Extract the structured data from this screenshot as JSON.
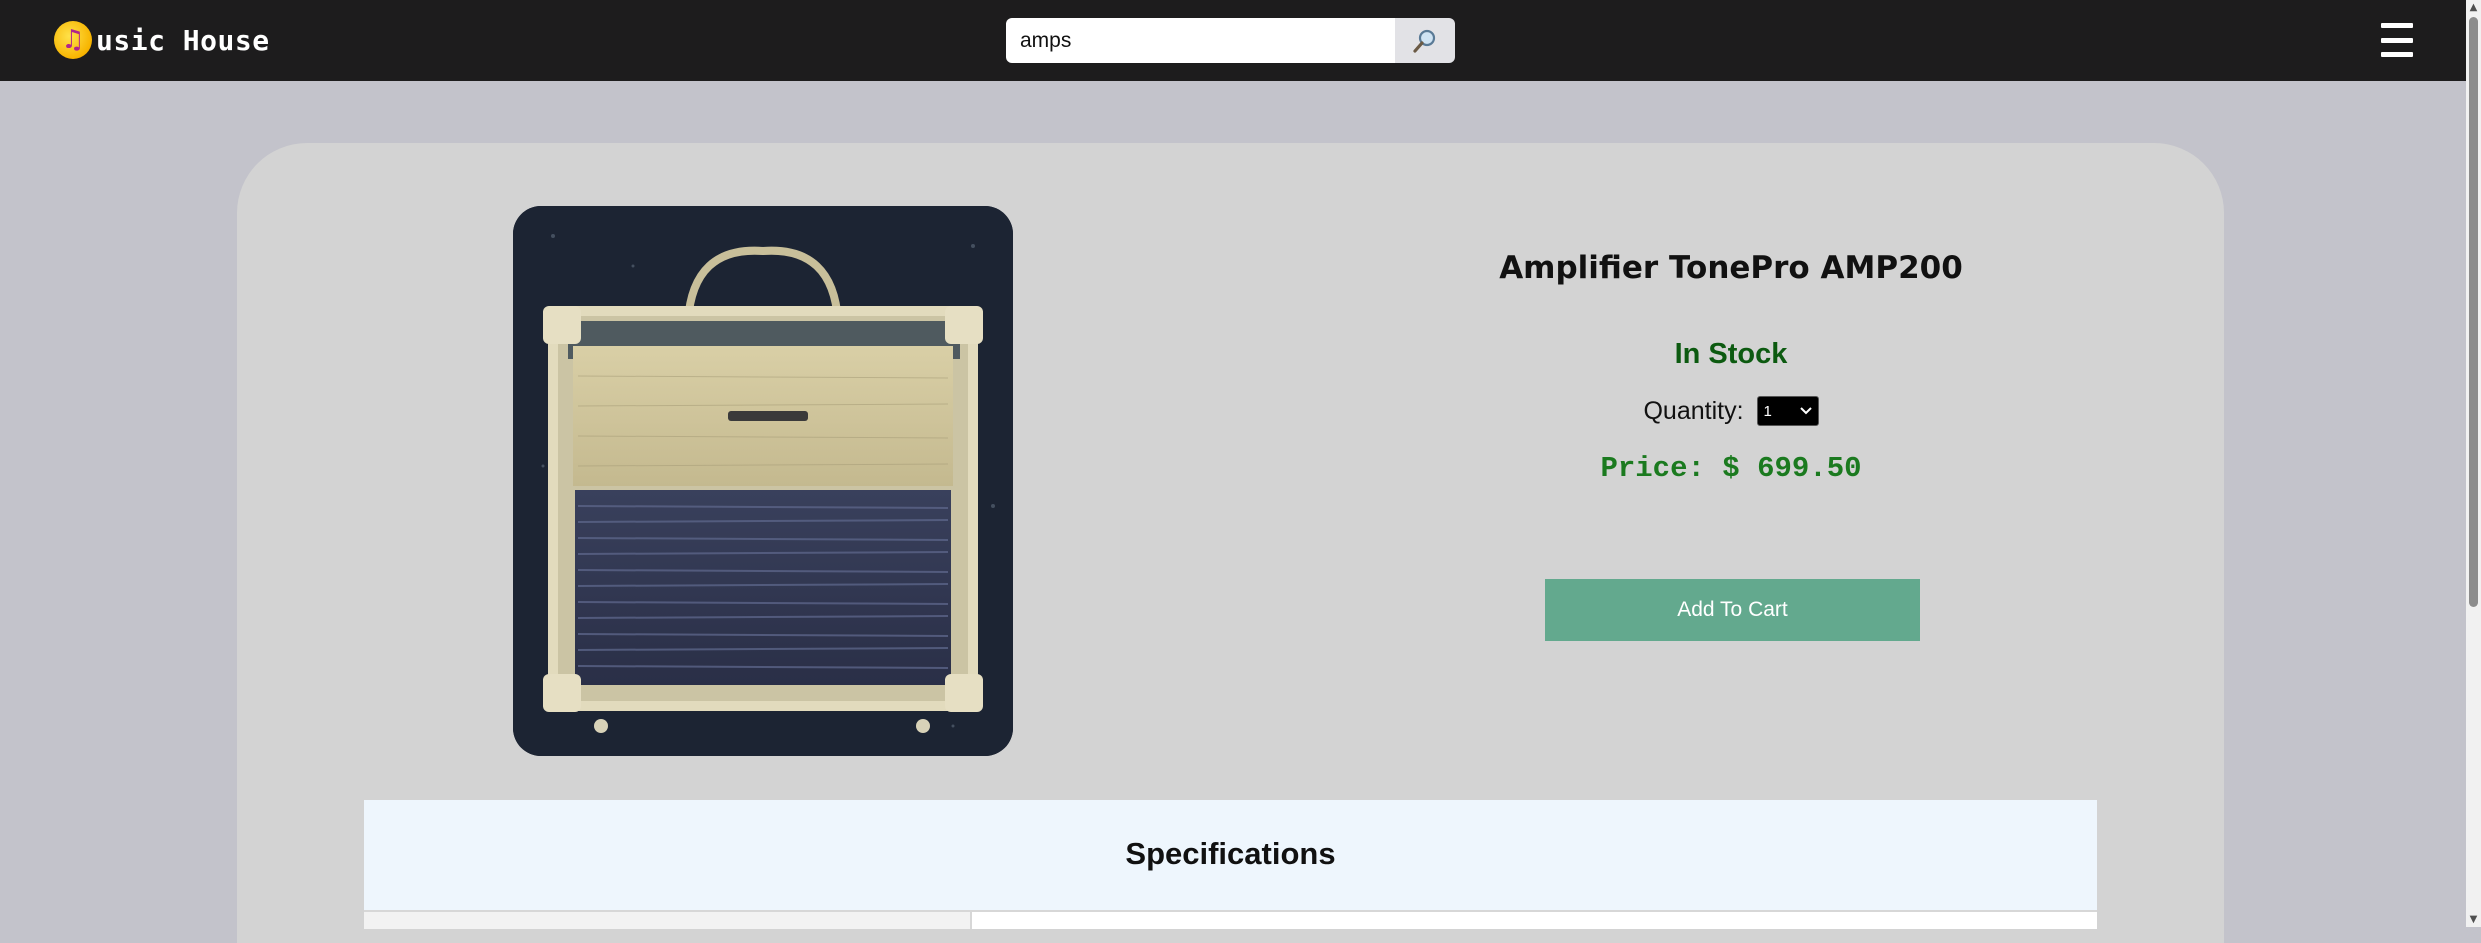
{
  "header": {
    "logo_mark": "♫",
    "logo_text": "usic House",
    "search": {
      "value": "amps",
      "button_icon": "magnifier-icon"
    },
    "menu_icon": "hamburger-icon"
  },
  "product": {
    "title": "Amplifier TonePro AMP200",
    "stock_status": "In Stock",
    "quantity_label": "Quantity:",
    "quantity_value": "1",
    "price": "Price: $ 699.50",
    "add_to_cart": "Add To Cart",
    "image_icon": "guitar-amplifier-image"
  },
  "specifications": {
    "heading": "Specifications"
  },
  "colors": {
    "navbar": "#1d1c1d",
    "page_bg": "#c3c3cb",
    "card_bg": "#d3d3d3",
    "stock_green": "#0c5a10",
    "price_green": "#1b7a1f",
    "cart_button": "#63a98e",
    "spec_bg": "#eef6fd"
  }
}
